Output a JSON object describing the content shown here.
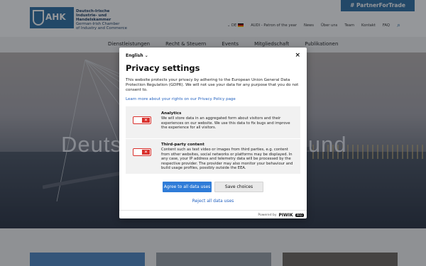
{
  "header": {
    "logo_text": "AHK",
    "org_line1": "Deutsch-Irische",
    "org_line2": "Industrie- und Handelskammer",
    "org_line3": "German-Irish Chamber",
    "org_line4": "of Industry and Commerce",
    "partner_button": "# PartnerForTrade",
    "topnav": {
      "lang": "DE",
      "items": [
        "AUDI - Patron of the year",
        "News",
        "Über uns",
        "Team",
        "Kontakt",
        "FAQ"
      ]
    },
    "mainnav": [
      "Dienstleistungen",
      "Recht & Steuern",
      "Events",
      "Mitgliedschaft",
      "Publikationen"
    ]
  },
  "hero": {
    "title_left": "Deuts",
    "title_right": "- und"
  },
  "modal": {
    "language": "English",
    "close_glyph": "×",
    "title": "Privacy settings",
    "intro": "This website protects your privacy by adhering to the European Union General Data Protection Regulation (GDPR). We will not use your data for any purpose that you do not consent to.",
    "privacy_link": "Learn more about your rights on our Privacy Policy page",
    "sections": [
      {
        "heading": "Analytics",
        "body": "We will store data in an aggregated form about visitors and their experiences on our website. We use this data to fix bugs and improve the experience for all visitors.",
        "toggle_glyph": "✕"
      },
      {
        "heading": "Third-party content",
        "body": "Content such as text video or images from third parties, e.g. content from other websites, social networks or platforms may be displayed. In any case, your IP address and telemetry data will be processed by the respective provider. The provider may also monitor your behaviour and build usage profiles, possibly outside the EEA.",
        "toggle_glyph": "✕"
      }
    ],
    "agree_button": "Agree to all data uses",
    "save_button": "Save choices",
    "reject_link": "Reject all data uses",
    "powered_by": "Powered by",
    "brand": "PIWIK",
    "brand_badge": "PRO"
  },
  "colors": {
    "accent": "#2f7cd8",
    "toggle_off": "#d9302c",
    "brand_blue": "#2f6fa5"
  }
}
